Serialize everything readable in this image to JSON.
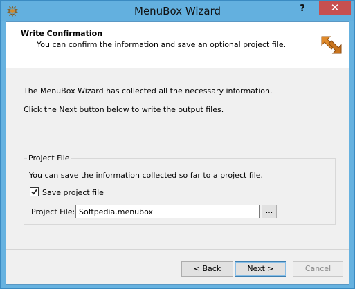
{
  "window": {
    "title": "MenuBox Wizard",
    "help_label": "?",
    "close_label": "✕"
  },
  "header": {
    "title": "Write Confirmation",
    "subtitle": "You can confirm the information and save an optional project file."
  },
  "body": {
    "line1": "The MenuBox Wizard has collected all the necessary information.",
    "line2": "Click the Next button below to write the output files."
  },
  "project_file_group": {
    "title": "Project File",
    "description": "You can save the information collected so far to a project file.",
    "save_checkbox_label": "Save project file",
    "save_checked": true,
    "file_label": "Project File:",
    "file_value": "Softpedia.menubox",
    "browse_label": "..."
  },
  "buttons": {
    "back": "< Back",
    "next": "Next >",
    "cancel": "Cancel"
  },
  "colors": {
    "titlebar": "#63b0df",
    "close_button": "#c75050",
    "dialog_background": "#f0f0f0",
    "header_background": "#ffffff"
  }
}
